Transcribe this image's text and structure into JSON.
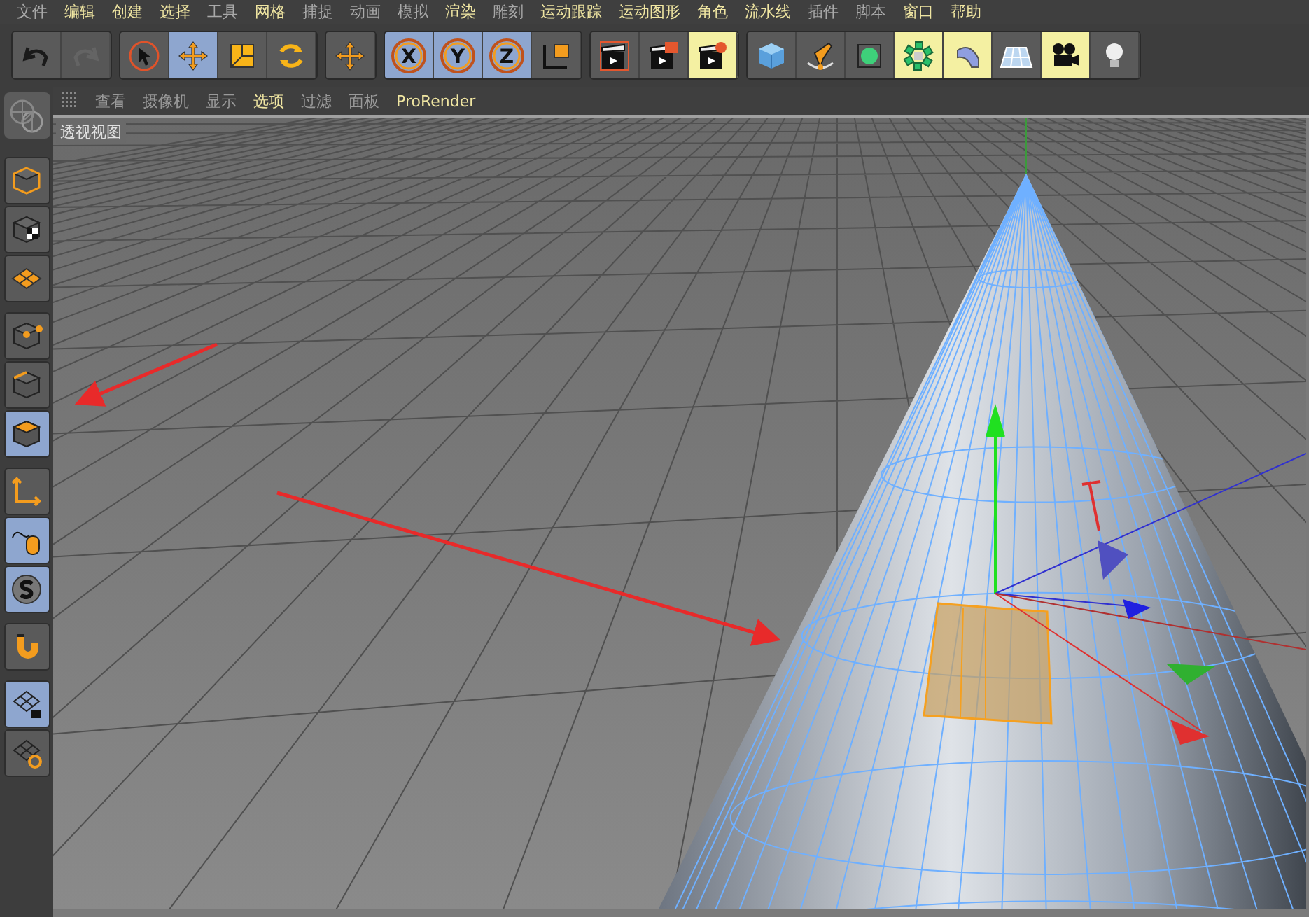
{
  "menu": [
    {
      "label": "文件",
      "highlighted": false
    },
    {
      "label": "编辑",
      "highlighted": true
    },
    {
      "label": "创建",
      "highlighted": true
    },
    {
      "label": "选择",
      "highlighted": true
    },
    {
      "label": "工具",
      "highlighted": false
    },
    {
      "label": "网格",
      "highlighted": true
    },
    {
      "label": "捕捉",
      "highlighted": false
    },
    {
      "label": "动画",
      "highlighted": false
    },
    {
      "label": "模拟",
      "highlighted": false
    },
    {
      "label": "渲染",
      "highlighted": true
    },
    {
      "label": "雕刻",
      "highlighted": false
    },
    {
      "label": "运动跟踪",
      "highlighted": true
    },
    {
      "label": "运动图形",
      "highlighted": true
    },
    {
      "label": "角色",
      "highlighted": true
    },
    {
      "label": "流水线",
      "highlighted": true
    },
    {
      "label": "插件",
      "highlighted": false
    },
    {
      "label": "脚本",
      "highlighted": false
    },
    {
      "label": "窗口",
      "highlighted": true
    },
    {
      "label": "帮助",
      "highlighted": true
    }
  ],
  "toolbar": [
    {
      "buttons": [
        {
          "kind": "undo",
          "selected": false,
          "highlighted": false,
          "disabled": false
        },
        {
          "kind": "redo",
          "selected": false,
          "highlighted": false,
          "disabled": true
        }
      ]
    },
    {
      "buttons": [
        {
          "kind": "select",
          "selected": false,
          "highlighted": false,
          "disabled": false
        },
        {
          "kind": "move",
          "selected": true,
          "highlighted": false,
          "disabled": false
        },
        {
          "kind": "scale",
          "selected": false,
          "highlighted": false,
          "disabled": false
        },
        {
          "kind": "rotate",
          "selected": false,
          "highlighted": false,
          "disabled": false
        }
      ]
    },
    {
      "buttons": [
        {
          "kind": "move",
          "selected": false,
          "highlighted": false,
          "disabled": false
        }
      ]
    },
    {
      "buttons": [
        {
          "kind": "axis-letter",
          "label": "X",
          "selected": true,
          "highlighted": false,
          "disabled": false
        },
        {
          "kind": "axis-letter",
          "label": "Y",
          "selected": true,
          "highlighted": false,
          "disabled": false
        },
        {
          "kind": "axis-letter",
          "label": "Z",
          "selected": true,
          "highlighted": false,
          "disabled": false
        },
        {
          "kind": "coords",
          "selected": false,
          "highlighted": false,
          "disabled": false
        }
      ]
    },
    {
      "buttons": [
        {
          "kind": "clapper",
          "selected": false,
          "highlighted": false,
          "disabled": false
        },
        {
          "kind": "clapper-picture",
          "selected": false,
          "highlighted": false,
          "disabled": false
        },
        {
          "kind": "clapper-gear",
          "selected": false,
          "highlighted": true,
          "disabled": false
        }
      ]
    },
    {
      "buttons": [
        {
          "kind": "cube",
          "selected": false,
          "highlighted": false,
          "disabled": false
        },
        {
          "kind": "pen",
          "selected": false,
          "highlighted": false,
          "disabled": false
        },
        {
          "kind": "subdivide",
          "selected": false,
          "highlighted": false,
          "disabled": false
        },
        {
          "kind": "cloner",
          "selected": false,
          "highlighted": true,
          "disabled": false
        },
        {
          "kind": "bend",
          "selected": false,
          "highlighted": true,
          "disabled": false
        },
        {
          "kind": "floor",
          "selected": false,
          "highlighted": false,
          "disabled": false
        },
        {
          "kind": "camera",
          "selected": false,
          "highlighted": true,
          "disabled": false
        },
        {
          "kind": "bulb",
          "selected": false,
          "highlighted": false,
          "disabled": false
        }
      ]
    }
  ],
  "viewport_menu": [
    {
      "label": "查看",
      "highlighted": false
    },
    {
      "label": "摄像机",
      "highlighted": false
    },
    {
      "label": "显示",
      "highlighted": false
    },
    {
      "label": "选项",
      "highlighted": true
    },
    {
      "label": "过滤",
      "highlighted": false
    },
    {
      "label": "面板",
      "highlighted": false
    },
    {
      "label": "ProRender",
      "highlighted": true
    }
  ],
  "viewport": {
    "title": "透视视图"
  },
  "sidebar": [
    {
      "buttons": [
        {
          "kind": "model",
          "selected": false
        },
        {
          "kind": "texture",
          "selected": false
        },
        {
          "kind": "workplane",
          "selected": false
        }
      ]
    },
    {
      "buttons": [
        {
          "kind": "points",
          "selected": false
        },
        {
          "kind": "edges",
          "selected": false
        },
        {
          "kind": "polygons",
          "selected": true
        }
      ]
    },
    {
      "buttons": [
        {
          "kind": "axis",
          "selected": false
        },
        {
          "kind": "tweak",
          "selected": true
        },
        {
          "kind": "solo",
          "selected": true
        }
      ]
    },
    {
      "buttons": [
        {
          "kind": "magnet",
          "selected": false
        }
      ]
    },
    {
      "buttons": [
        {
          "kind": "grid-lock",
          "selected": true
        },
        {
          "kind": "grid-rotate",
          "selected": false
        }
      ]
    }
  ]
}
